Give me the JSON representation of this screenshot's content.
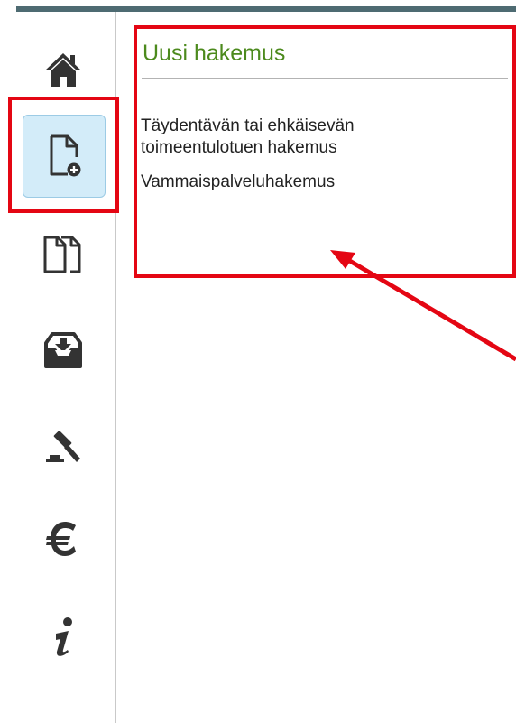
{
  "sidebar": {
    "items": [
      {
        "name": "nav-home",
        "icon": "home-icon",
        "active": false
      },
      {
        "name": "nav-new-application",
        "icon": "new-document-icon",
        "active": true
      },
      {
        "name": "nav-applications",
        "icon": "documents-icon",
        "active": false
      },
      {
        "name": "nav-inbox",
        "icon": "inbox-download-icon",
        "active": false
      },
      {
        "name": "nav-decisions",
        "icon": "gavel-icon",
        "active": false
      },
      {
        "name": "nav-payments",
        "icon": "euro-icon",
        "active": false
      },
      {
        "name": "nav-info",
        "icon": "info-icon",
        "active": false
      }
    ]
  },
  "main": {
    "title": "Uusi hakemus",
    "applications": [
      {
        "label": "Täydentävän tai ehkäisevän toimeentulotuen hakemus"
      },
      {
        "label": "Vammaispalveluhakemus"
      }
    ]
  },
  "colors": {
    "topbar": "#4e6b72",
    "title": "#4c8a1d",
    "active_bg": "#d3ecf9",
    "icon": "#333333",
    "annotation": "#e40613"
  }
}
